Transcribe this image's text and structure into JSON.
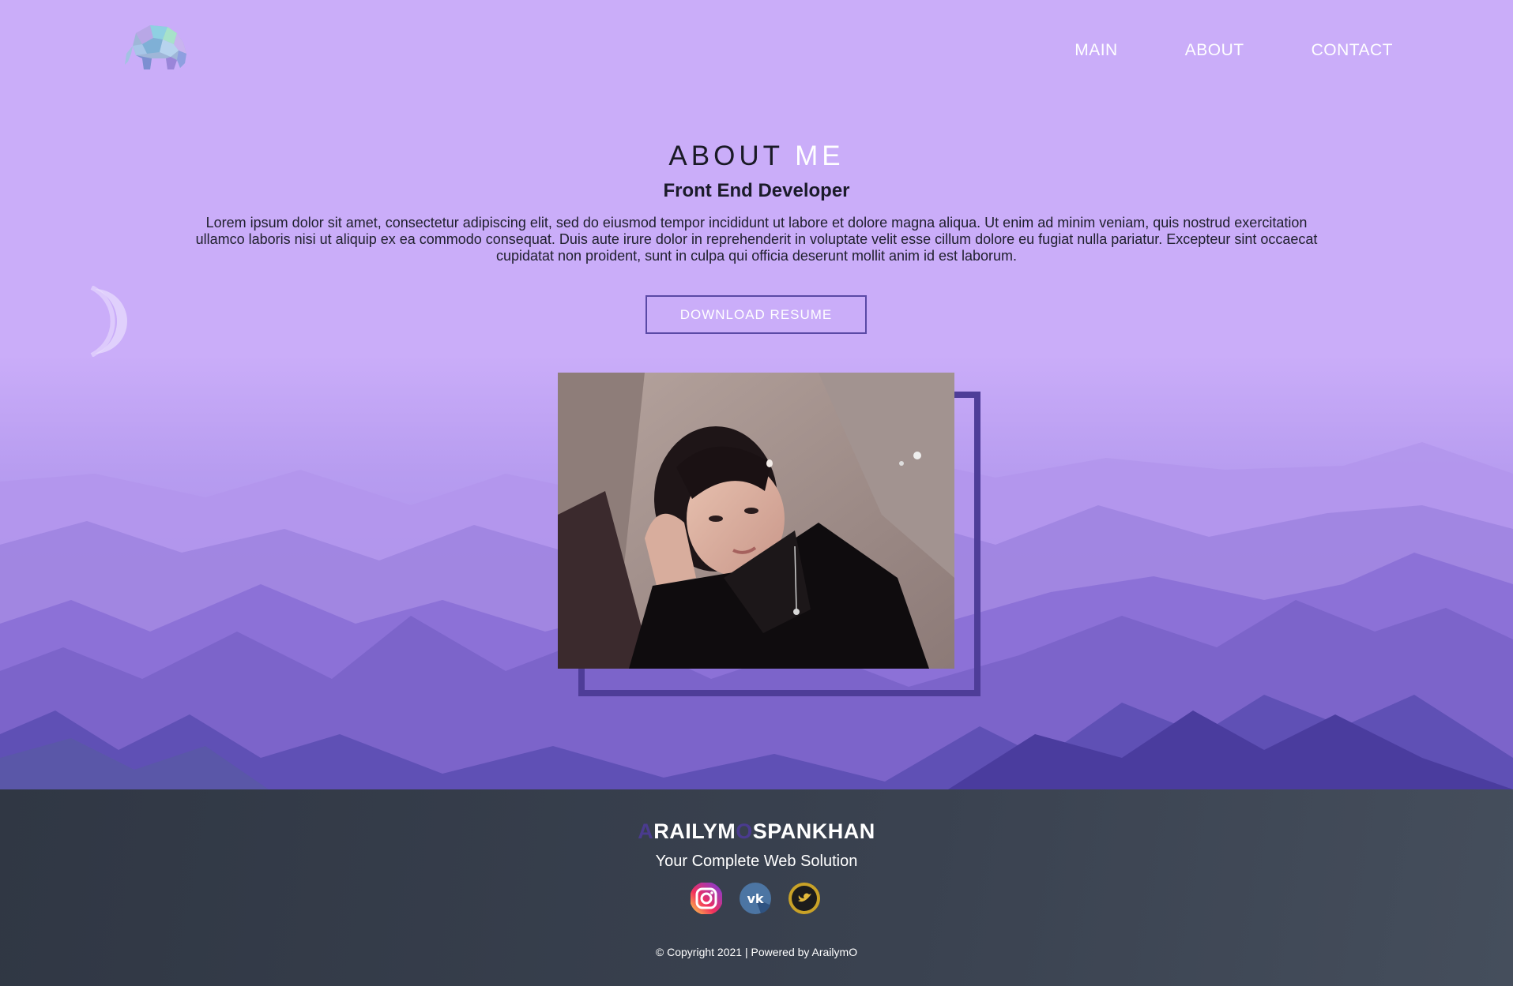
{
  "nav": {
    "items": [
      {
        "label": "MAIN"
      },
      {
        "label": "ABOUT"
      },
      {
        "label": "CONTACT"
      }
    ]
  },
  "about": {
    "heading_main": "ABOUT",
    "heading_accent": "ME",
    "subtitle": "Front End Developer",
    "description": "Lorem ipsum dolor sit amet, consectetur adipiscing elit, sed do eiusmod tempor incididunt ut labore et dolore magna aliqua. Ut enim ad minim veniam, quis nostrud exercitation ullamco laboris nisi ut aliquip ex ea commodo consequat. Duis aute irure dolor in reprehenderit in voluptate velit esse cillum dolore eu fugiat nulla pariatur. Excepteur sint occaecat cupidatat non proident, sunt in culpa qui officia deserunt mollit anim id est laborum.",
    "button_label": "DOWNLOAD RESUME"
  },
  "footer": {
    "brand_a": "A",
    "brand_mid": "RAILYM",
    "brand_o": "O",
    "brand_end": "SPANKHAN",
    "tagline": "Your Complete Web Solution",
    "socials": [
      {
        "icon": "instagram-icon"
      },
      {
        "icon": "vk-icon"
      },
      {
        "icon": "twitter-icon"
      }
    ],
    "copyright": "© Copyright 2021 | Powered by ArailymO"
  },
  "colors": {
    "hero_bg": "#caadf9",
    "accent_dark": "#4e3d98",
    "footer_bg": "#363d4a"
  }
}
